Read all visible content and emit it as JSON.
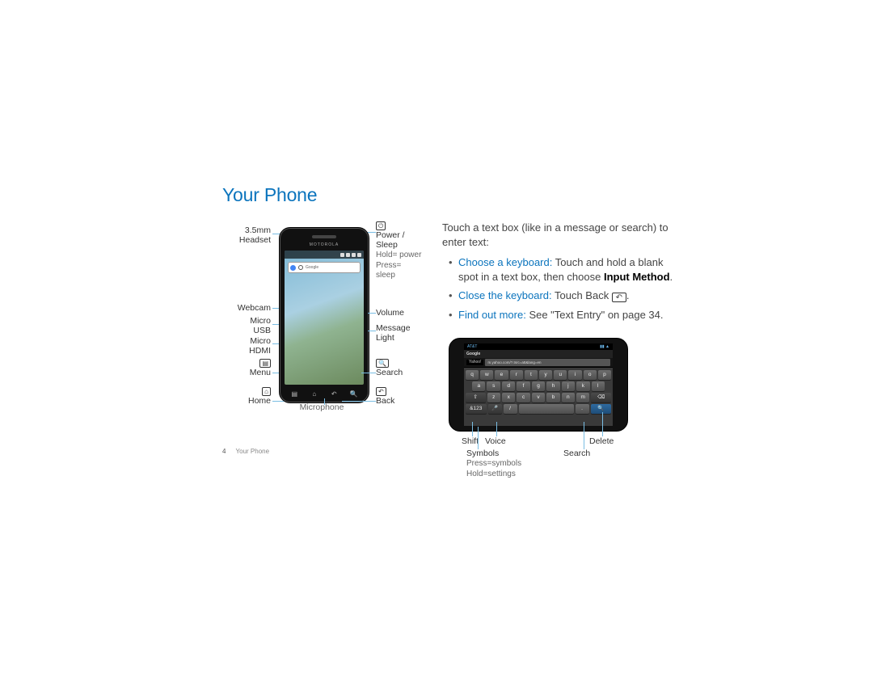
{
  "title": "Your Phone",
  "page_number": "4",
  "footer_section": "Your Phone",
  "intro": "Touch a text box (like in a message or search) to enter text:",
  "bullets": [
    {
      "lead": "Choose a keyboard:",
      "text": " Touch and hold a blank spot in a text box, then choose ",
      "method": "Input Method",
      "tail": "."
    },
    {
      "lead": "Close the keyboard:",
      "text": " Touch Back ",
      "back_glyph": "↶",
      "tail": "."
    },
    {
      "lead": "Find out more:",
      "text": " See \"Text Entry\" on page 34."
    }
  ],
  "phone_vertical": {
    "brand": "MOTOROLA",
    "search_placeholder": "Google",
    "left_labels": {
      "headset": "3.5mm\nHeadset",
      "webcam": "Webcam",
      "usb": "Micro\nUSB",
      "hdmi": "Micro\nHDMI",
      "menu_icon": "▤",
      "menu": "Menu",
      "home_icon": "⌂",
      "home": "Home"
    },
    "right_labels": {
      "power_icon": "⏻",
      "power": "Power / Sleep",
      "power_sub": "Hold= power\nPress= sleep",
      "volume": "Volume",
      "msglight": "Message\nLight",
      "search_icon": "🔍",
      "search": "Search",
      "back_icon": "↶",
      "back": "Back"
    },
    "center_label": "Microphone"
  },
  "phone_horizontal": {
    "statusbar": "AT&T",
    "google": "Google",
    "host_tab": "Yahoo!",
    "url_text": "m.yahoo.com/?.tsrc=att&lang=en",
    "rows": [
      [
        "q",
        "w",
        "e",
        "r",
        "t",
        "y",
        "u",
        "i",
        "o",
        "p"
      ],
      [
        "a",
        "s",
        "d",
        "f",
        "g",
        "h",
        "j",
        "k",
        "l"
      ]
    ],
    "row3": {
      "shift": "⇧",
      "z": "z",
      "x": "x",
      "c": "c",
      "v": "v",
      "b": "b",
      "n": "n",
      "m": "m",
      "del": "⌫"
    },
    "row4": {
      "sym": "&123",
      "mic": "🎤",
      "slash": "/",
      "space": "",
      "dot": ".",
      "search": "🔍"
    },
    "callouts": {
      "shift": "Shift",
      "voice": "Voice",
      "symbols": "Symbols",
      "symbols_sub": "Press=symbols\nHold=settings",
      "delete": "Delete",
      "search": "Search"
    }
  }
}
